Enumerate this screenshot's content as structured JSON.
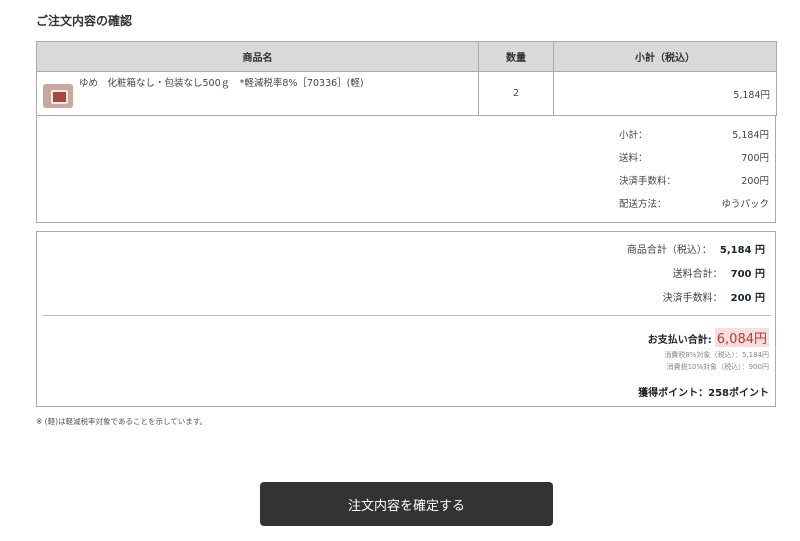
{
  "section_title": "ご注文内容の確認",
  "table": {
    "headers": {
      "name": "商品名",
      "qty": "数量",
      "subtotal": "小計（税込）"
    },
    "rows": [
      {
        "name": "ゆめ　化粧箱なし・包装なし500ｇ　*軽減税率8%［70336］(軽)",
        "qty": "2",
        "subtotal": "5,184円"
      }
    ]
  },
  "summary": {
    "subtotal_label": "小計：",
    "subtotal_value": "5,184円",
    "shipping_label": "送料：",
    "shipping_value": "700円",
    "fee_label": "決済手数料：",
    "fee_value": "200円",
    "delivery_label": "配送方法：",
    "delivery_value": "ゆうパック"
  },
  "totals": {
    "goods_label": "商品合計（税込）：",
    "goods_value": "5,184 円",
    "shipping_label": "送料合計：",
    "shipping_value": "700 円",
    "fee_label": "決済手数料：",
    "fee_value": "200 円",
    "payment_label": "お支払い合計:",
    "payment_value": "6,084円",
    "tax8": "消費税8%対象（税込）：5,184円",
    "tax10": "消費税10%対象（税込）：900円",
    "points": "獲得ポイント：258ポイント"
  },
  "note": "※ (軽)は軽減税率対象であることを示しています。",
  "confirm_button": "注文内容を確定する",
  "colors": {
    "button_bg": "#333333",
    "total_accent": "#c0392b",
    "header_bg": "#d9d9d9"
  }
}
